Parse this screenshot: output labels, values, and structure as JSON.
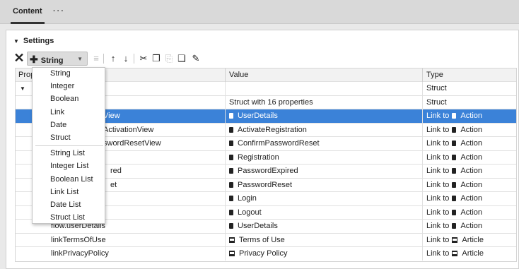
{
  "tabs": {
    "active": "Content",
    "more": "···"
  },
  "section": {
    "title": "Settings"
  },
  "toolbar": {
    "add_label": "String"
  },
  "grid": {
    "columns": {
      "property": "Property",
      "value": "Value",
      "type": "Type"
    },
    "rows": [
      {
        "prop": "",
        "value": "",
        "type": "Struct"
      },
      {
        "prop": "",
        "value": "Struct with 16 properties",
        "type": "Struct"
      },
      {
        "prop": "View",
        "value": "UserDetails",
        "type_prefix": "Link to",
        "type_name": "Action"
      },
      {
        "prop": "ActivationView",
        "value": "ActivateRegistration",
        "type_prefix": "Link to",
        "type_name": "Action"
      },
      {
        "prop": "swordResetView",
        "value": "ConfirmPasswordReset",
        "type_prefix": "Link to",
        "type_name": "Action"
      },
      {
        "prop": "",
        "value": "Registration",
        "type_prefix": "Link to",
        "type_name": "Action"
      },
      {
        "prop": "red",
        "value": "PasswordExpired",
        "type_prefix": "Link to",
        "type_name": "Action"
      },
      {
        "prop": "et",
        "value": "PasswordReset",
        "type_prefix": "Link to",
        "type_name": "Action"
      },
      {
        "prop": "",
        "value": "Login",
        "type_prefix": "Link to",
        "type_name": "Action"
      },
      {
        "prop": "",
        "value": "Logout",
        "type_prefix": "Link to",
        "type_name": "Action"
      },
      {
        "prop": "flow.userDetails",
        "value": "UserDetails",
        "type_prefix": "Link to",
        "type_name": "Action"
      },
      {
        "prop": "linkTermsOfUse",
        "value": "Terms of Use",
        "type_prefix": "Link to",
        "type_name": "Article"
      },
      {
        "prop": "linkPrivacyPolicy",
        "value": "Privacy Policy",
        "type_prefix": "Link to",
        "type_name": "Article"
      }
    ]
  },
  "menu": {
    "items": [
      "String",
      "Integer",
      "Boolean",
      "Link",
      "Date",
      "Struct"
    ],
    "list_items": [
      "String List",
      "Integer List",
      "Boolean List",
      "Link List",
      "Date List",
      "Struct List"
    ]
  },
  "colors": {
    "selected_row": "#3b82d8",
    "tab_bar": "#d9d9d9"
  }
}
